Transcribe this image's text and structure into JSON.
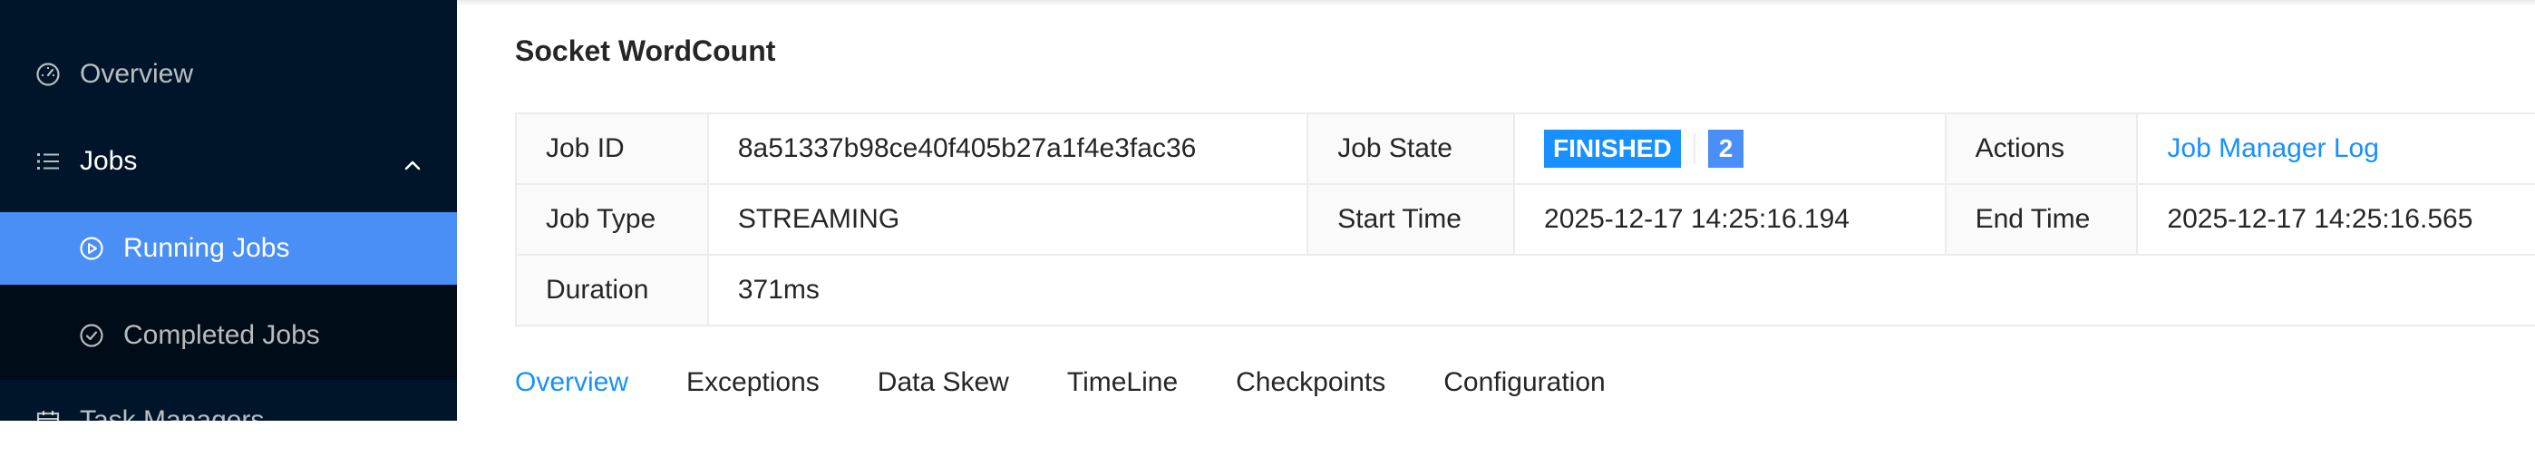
{
  "sidebar": {
    "items": [
      {
        "label": "Overview",
        "icon": "dashboard-icon"
      },
      {
        "label": "Jobs",
        "icon": "list-icon",
        "expanded": true
      },
      {
        "label": "Running Jobs",
        "icon": "play-circle-icon",
        "active": true
      },
      {
        "label": "Completed Jobs",
        "icon": "check-circle-icon"
      },
      {
        "label": "Task Managers",
        "icon": "calendar-icon"
      }
    ]
  },
  "job": {
    "title": "Socket WordCount",
    "fields": {
      "job_id_label": "Job ID",
      "job_id": "8a51337b98ce40f405b27a1f4e3fac36",
      "job_state_label": "Job State",
      "job_state": "FINISHED",
      "task_count": "2",
      "actions_label": "Actions",
      "actions_link": "Job Manager Log",
      "job_type_label": "Job Type",
      "job_type": "STREAMING",
      "start_time_label": "Start Time",
      "start_time": "2025-12-17 14:25:16.194",
      "end_time_label": "End Time",
      "end_time": "2025-12-17 14:25:16.565",
      "duration_label": "Duration",
      "duration": "371ms"
    }
  },
  "tabs": [
    {
      "label": "Overview",
      "active": true
    },
    {
      "label": "Exceptions"
    },
    {
      "label": "Data Skew"
    },
    {
      "label": "TimeLine"
    },
    {
      "label": "Checkpoints"
    },
    {
      "label": "Configuration"
    }
  ],
  "colors": {
    "sidebar_bg": "#001529",
    "active_item": "#4a8ff5",
    "accent": "#1890ff"
  }
}
